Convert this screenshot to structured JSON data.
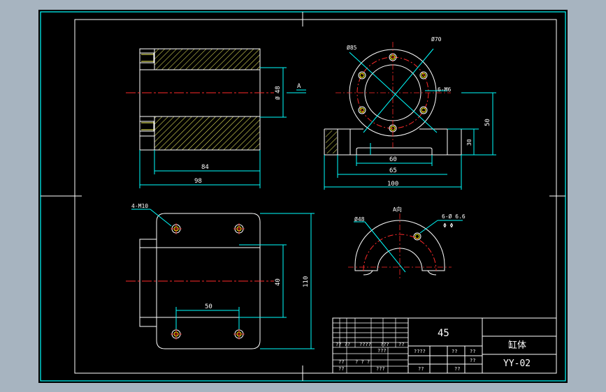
{
  "drawing": {
    "colors": {
      "background": "#000000",
      "frame": "#ffffff",
      "outline": "#ffffff",
      "dimension": "#00ffff",
      "centerline": "#ff2a2a",
      "hatch": "#ffff66",
      "hole": "#ffff00",
      "text": "#ffffff",
      "page": "#a7b4c0"
    },
    "top_left_view": {
      "dim_48": "48",
      "dim_48_sub": "Ø",
      "dim_84": "84",
      "dim_98": "98",
      "section_label": "A"
    },
    "top_right_view": {
      "dim_d85": "Ø85",
      "dim_d70": "Ø70",
      "dim_6m6": "6-M6",
      "dim_50": "50",
      "dim_30": "30",
      "dim_60": "60",
      "dim_65": "65",
      "dim_100": "100"
    },
    "bottom_left_view": {
      "dim_4m10": "4-M10",
      "dim_40": "40",
      "dim_110": "110",
      "dim_50": "50"
    },
    "bottom_right_view": {
      "view_label": "A向",
      "dim_d48": "Ø48",
      "dim_holes": "6-Ø 6.6",
      "dim_holes_sub": "Φ  Φ"
    },
    "title_block": {
      "material": "45",
      "part_name": "缸体",
      "drawing_number": "YY-02",
      "left_labels": [
        "?? ??",
        "????",
        "???",
        "??",
        "???",
        "??",
        "? ? ?",
        "???",
        "??"
      ],
      "mid_labels": [
        "????",
        "??",
        "??",
        "??",
        "??",
        "??"
      ]
    }
  }
}
